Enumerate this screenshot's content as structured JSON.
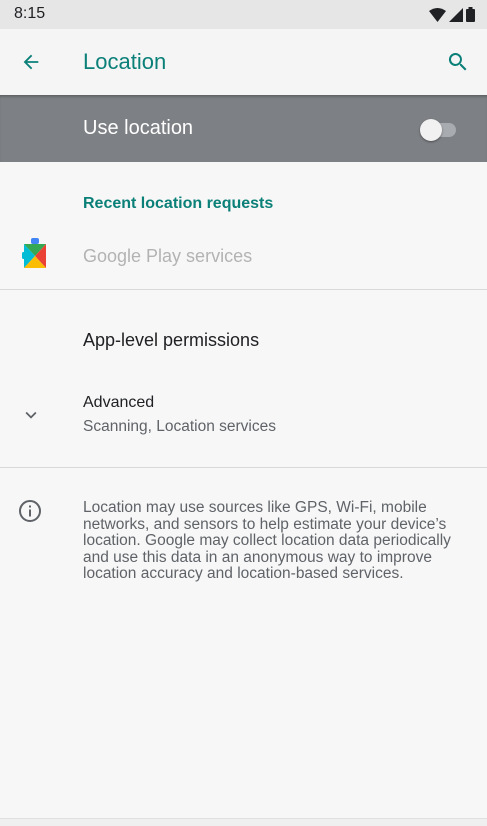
{
  "status_bar": {
    "time": "8:15",
    "icons": [
      "wifi-icon",
      "signal-icon",
      "battery-icon"
    ]
  },
  "app_bar": {
    "title": "Location",
    "back_icon": "arrow-back-icon",
    "search_icon": "search-icon"
  },
  "master_switch": {
    "label": "Use location",
    "checked": false
  },
  "recent_requests": {
    "header": "Recent location requests",
    "apps": [
      {
        "name": "Google Play services",
        "icon": "google-play-services-icon"
      }
    ]
  },
  "app_level_permissions": {
    "label": "App-level permissions"
  },
  "advanced": {
    "title": "Advanced",
    "summary": "Scanning, Location services",
    "icon": "chevron-down-icon"
  },
  "footer": {
    "icon": "info-icon",
    "text": "Location may use sources like GPS, Wi-Fi, mobile networks, and sensors to help estimate your device’s location. Google may collect location data periodically and use this data in an anonymous way to improve location accuracy and location-based services."
  },
  "colors": {
    "accent": "#0b8078",
    "master_bar_bg": "#7d8084",
    "background": "#f7f7f7"
  }
}
